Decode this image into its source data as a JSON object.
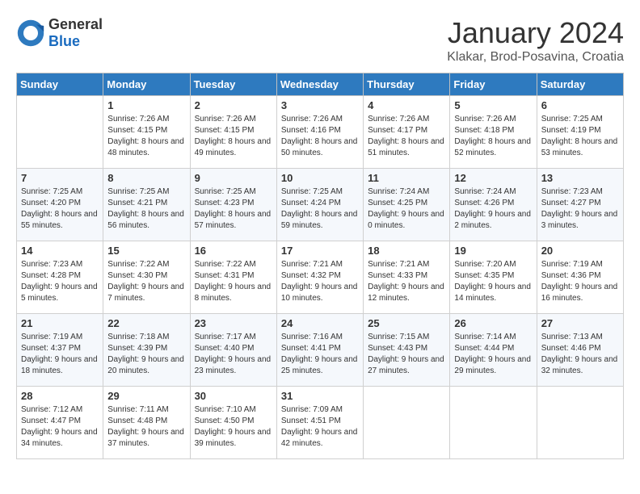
{
  "header": {
    "logo_general": "General",
    "logo_blue": "Blue",
    "month_title": "January 2024",
    "location": "Klakar, Brod-Posavina, Croatia"
  },
  "weekdays": [
    "Sunday",
    "Monday",
    "Tuesday",
    "Wednesday",
    "Thursday",
    "Friday",
    "Saturday"
  ],
  "weeks": [
    [
      {
        "day": "",
        "sunrise": "",
        "sunset": "",
        "daylight": ""
      },
      {
        "day": "1",
        "sunrise": "Sunrise: 7:26 AM",
        "sunset": "Sunset: 4:15 PM",
        "daylight": "Daylight: 8 hours and 48 minutes."
      },
      {
        "day": "2",
        "sunrise": "Sunrise: 7:26 AM",
        "sunset": "Sunset: 4:15 PM",
        "daylight": "Daylight: 8 hours and 49 minutes."
      },
      {
        "day": "3",
        "sunrise": "Sunrise: 7:26 AM",
        "sunset": "Sunset: 4:16 PM",
        "daylight": "Daylight: 8 hours and 50 minutes."
      },
      {
        "day": "4",
        "sunrise": "Sunrise: 7:26 AM",
        "sunset": "Sunset: 4:17 PM",
        "daylight": "Daylight: 8 hours and 51 minutes."
      },
      {
        "day": "5",
        "sunrise": "Sunrise: 7:26 AM",
        "sunset": "Sunset: 4:18 PM",
        "daylight": "Daylight: 8 hours and 52 minutes."
      },
      {
        "day": "6",
        "sunrise": "Sunrise: 7:25 AM",
        "sunset": "Sunset: 4:19 PM",
        "daylight": "Daylight: 8 hours and 53 minutes."
      }
    ],
    [
      {
        "day": "7",
        "sunrise": "Sunrise: 7:25 AM",
        "sunset": "Sunset: 4:20 PM",
        "daylight": "Daylight: 8 hours and 55 minutes."
      },
      {
        "day": "8",
        "sunrise": "Sunrise: 7:25 AM",
        "sunset": "Sunset: 4:21 PM",
        "daylight": "Daylight: 8 hours and 56 minutes."
      },
      {
        "day": "9",
        "sunrise": "Sunrise: 7:25 AM",
        "sunset": "Sunset: 4:23 PM",
        "daylight": "Daylight: 8 hours and 57 minutes."
      },
      {
        "day": "10",
        "sunrise": "Sunrise: 7:25 AM",
        "sunset": "Sunset: 4:24 PM",
        "daylight": "Daylight: 8 hours and 59 minutes."
      },
      {
        "day": "11",
        "sunrise": "Sunrise: 7:24 AM",
        "sunset": "Sunset: 4:25 PM",
        "daylight": "Daylight: 9 hours and 0 minutes."
      },
      {
        "day": "12",
        "sunrise": "Sunrise: 7:24 AM",
        "sunset": "Sunset: 4:26 PM",
        "daylight": "Daylight: 9 hours and 2 minutes."
      },
      {
        "day": "13",
        "sunrise": "Sunrise: 7:23 AM",
        "sunset": "Sunset: 4:27 PM",
        "daylight": "Daylight: 9 hours and 3 minutes."
      }
    ],
    [
      {
        "day": "14",
        "sunrise": "Sunrise: 7:23 AM",
        "sunset": "Sunset: 4:28 PM",
        "daylight": "Daylight: 9 hours and 5 minutes."
      },
      {
        "day": "15",
        "sunrise": "Sunrise: 7:22 AM",
        "sunset": "Sunset: 4:30 PM",
        "daylight": "Daylight: 9 hours and 7 minutes."
      },
      {
        "day": "16",
        "sunrise": "Sunrise: 7:22 AM",
        "sunset": "Sunset: 4:31 PM",
        "daylight": "Daylight: 9 hours and 8 minutes."
      },
      {
        "day": "17",
        "sunrise": "Sunrise: 7:21 AM",
        "sunset": "Sunset: 4:32 PM",
        "daylight": "Daylight: 9 hours and 10 minutes."
      },
      {
        "day": "18",
        "sunrise": "Sunrise: 7:21 AM",
        "sunset": "Sunset: 4:33 PM",
        "daylight": "Daylight: 9 hours and 12 minutes."
      },
      {
        "day": "19",
        "sunrise": "Sunrise: 7:20 AM",
        "sunset": "Sunset: 4:35 PM",
        "daylight": "Daylight: 9 hours and 14 minutes."
      },
      {
        "day": "20",
        "sunrise": "Sunrise: 7:19 AM",
        "sunset": "Sunset: 4:36 PM",
        "daylight": "Daylight: 9 hours and 16 minutes."
      }
    ],
    [
      {
        "day": "21",
        "sunrise": "Sunrise: 7:19 AM",
        "sunset": "Sunset: 4:37 PM",
        "daylight": "Daylight: 9 hours and 18 minutes."
      },
      {
        "day": "22",
        "sunrise": "Sunrise: 7:18 AM",
        "sunset": "Sunset: 4:39 PM",
        "daylight": "Daylight: 9 hours and 20 minutes."
      },
      {
        "day": "23",
        "sunrise": "Sunrise: 7:17 AM",
        "sunset": "Sunset: 4:40 PM",
        "daylight": "Daylight: 9 hours and 23 minutes."
      },
      {
        "day": "24",
        "sunrise": "Sunrise: 7:16 AM",
        "sunset": "Sunset: 4:41 PM",
        "daylight": "Daylight: 9 hours and 25 minutes."
      },
      {
        "day": "25",
        "sunrise": "Sunrise: 7:15 AM",
        "sunset": "Sunset: 4:43 PM",
        "daylight": "Daylight: 9 hours and 27 minutes."
      },
      {
        "day": "26",
        "sunrise": "Sunrise: 7:14 AM",
        "sunset": "Sunset: 4:44 PM",
        "daylight": "Daylight: 9 hours and 29 minutes."
      },
      {
        "day": "27",
        "sunrise": "Sunrise: 7:13 AM",
        "sunset": "Sunset: 4:46 PM",
        "daylight": "Daylight: 9 hours and 32 minutes."
      }
    ],
    [
      {
        "day": "28",
        "sunrise": "Sunrise: 7:12 AM",
        "sunset": "Sunset: 4:47 PM",
        "daylight": "Daylight: 9 hours and 34 minutes."
      },
      {
        "day": "29",
        "sunrise": "Sunrise: 7:11 AM",
        "sunset": "Sunset: 4:48 PM",
        "daylight": "Daylight: 9 hours and 37 minutes."
      },
      {
        "day": "30",
        "sunrise": "Sunrise: 7:10 AM",
        "sunset": "Sunset: 4:50 PM",
        "daylight": "Daylight: 9 hours and 39 minutes."
      },
      {
        "day": "31",
        "sunrise": "Sunrise: 7:09 AM",
        "sunset": "Sunset: 4:51 PM",
        "daylight": "Daylight: 9 hours and 42 minutes."
      },
      {
        "day": "",
        "sunrise": "",
        "sunset": "",
        "daylight": ""
      },
      {
        "day": "",
        "sunrise": "",
        "sunset": "",
        "daylight": ""
      },
      {
        "day": "",
        "sunrise": "",
        "sunset": "",
        "daylight": ""
      }
    ]
  ]
}
